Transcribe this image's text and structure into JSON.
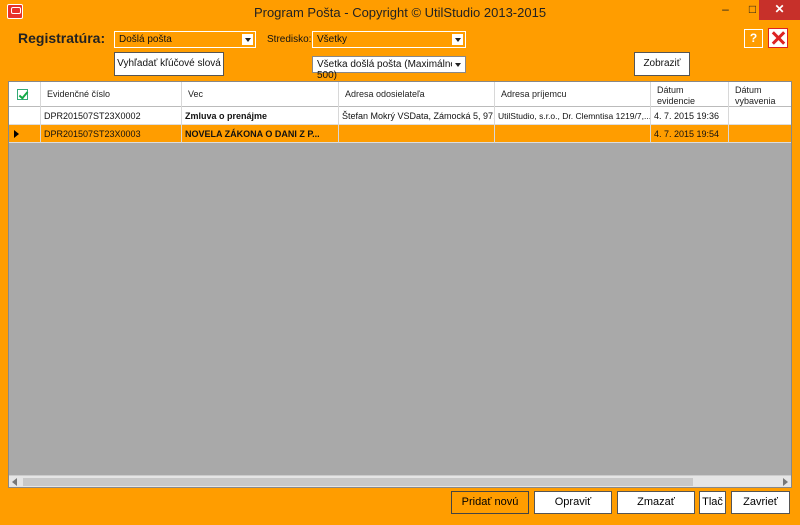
{
  "window": {
    "title": "Program Pošta - Copyright © UtilStudio 2013-2015",
    "min": "–",
    "max": "□",
    "close": "✕"
  },
  "header": {
    "registratura_label": "Registratúra:",
    "registratura_value": "Došlá pošta",
    "stredisko_label": "Stredisko:",
    "stredisko_value": "Všetky",
    "filter_value": "Všetka došlá pošta (Maximálne 500)",
    "search_button": "Vyhľadať kľúčové slová",
    "show_button": "Zobraziť",
    "help": "?"
  },
  "grid": {
    "columns": [
      "Evidenčné číslo",
      "Vec",
      "Adresa odosielateľa",
      "Adresa príjemcu",
      "Dátum evidencie",
      "Dátum vybavenia"
    ],
    "column_lines": [
      [
        "Evidenčné číslo"
      ],
      [
        "Vec"
      ],
      [
        "Adresa odosielateľa"
      ],
      [
        "Adresa príjemcu"
      ],
      [
        "Dátum",
        "evidencie"
      ],
      [
        "Dátum",
        "vybavenia"
      ]
    ],
    "rows": [
      {
        "ev": "DPR201507ST23X0002",
        "vec": "Zmluva o prenájme",
        "odos": "Štefan Mokrý VSData, Zámocká 5, 97...",
        "prij": "UtilStudio, s.r.o., Dr. Clemntisa 1219/7,...",
        "dat_ev": "4. 7. 2015 19:36",
        "dat_vyb": ""
      },
      {
        "ev": "DPR201507ST23X0003",
        "vec": "NOVELA ZÁKONA O DANI Z P...",
        "odos": "",
        "prij": "",
        "dat_ev": "4. 7. 2015 19:54",
        "dat_vyb": ""
      }
    ]
  },
  "footer": {
    "add": "Pridať novú",
    "edit": "Opraviť",
    "delete": "Zmazať",
    "print": "Tlač",
    "close": "Zavrieť"
  },
  "colors": {
    "accent": "#ff9d00",
    "grid_bg": "#a9a9a9"
  }
}
